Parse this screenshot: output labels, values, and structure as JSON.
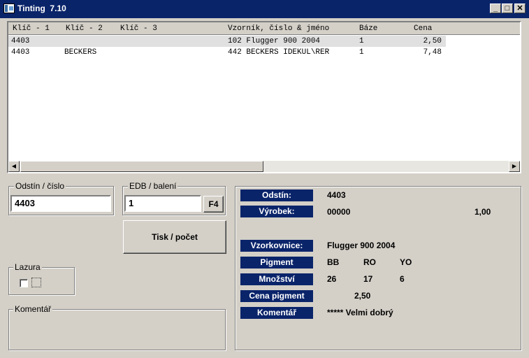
{
  "window": {
    "title": "Tinting  7.10",
    "minimize_label": "_",
    "maximize_label": "□",
    "close_label": "✕"
  },
  "list": {
    "headers": [
      "Klíč - 1",
      "Klíč - 2",
      "Klíč - 3",
      "Vzorník, číslo & jméno",
      "Báze",
      "Cena"
    ],
    "rows": [
      {
        "key1": "4403",
        "key2": "",
        "key3": "",
        "swatch": "102 Flugger 900 2004",
        "base": "1",
        "price": "2,50"
      },
      {
        "key1": "4403",
        "key2": "BECKERS",
        "key3": "",
        "swatch": "442 BECKERS IDEKUL\\RER",
        "base": "1",
        "price": "7,48"
      }
    ],
    "scroll_left_icon": "◀",
    "scroll_right_icon": "▶"
  },
  "shade": {
    "label": "Odstín / číslo",
    "value": "4403"
  },
  "edb": {
    "label": "EDB / balení",
    "value": "1",
    "f4_label": "F4"
  },
  "print_button": "Tisk / počet",
  "lazura": {
    "label": "Lazura"
  },
  "comment_box": {
    "label": "Komentář"
  },
  "details": {
    "odstin": {
      "label": "Odstín:",
      "value": "4403"
    },
    "vyrobek": {
      "label": "Výrobek:",
      "value": "00000",
      "amount": "1,00"
    },
    "vzorkovnice": {
      "label": "Vzorkovnice:",
      "value": "Flugger 900 2004"
    },
    "pigment": {
      "label": "Pigment",
      "values": [
        "BB",
        "RO",
        "YO"
      ]
    },
    "mnozstvi": {
      "label": "Množství",
      "values": [
        "26",
        "17",
        "6"
      ]
    },
    "cena_pigment": {
      "label": "Cena pigment",
      "value": "2,50"
    },
    "komentar": {
      "label": "Komentář",
      "value": "***** Velmi dobrý"
    }
  }
}
